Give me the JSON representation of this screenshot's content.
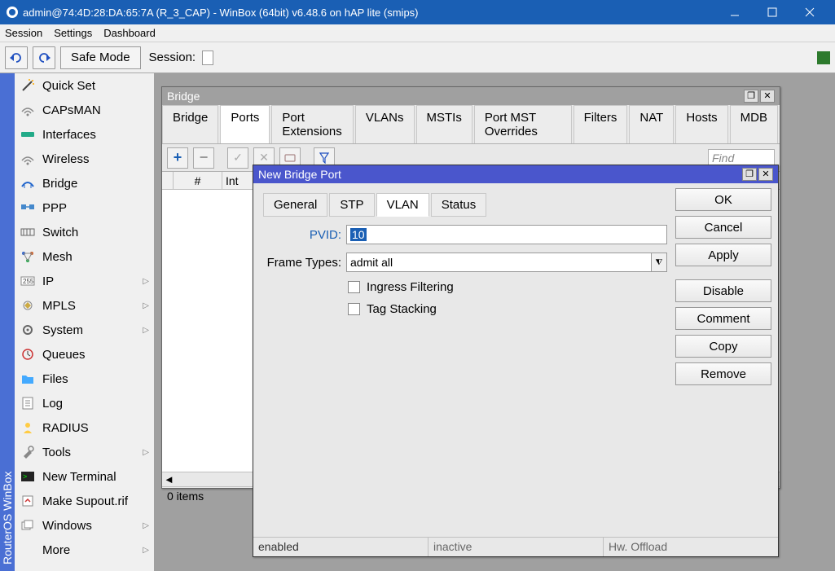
{
  "title": "admin@74:4D:28:DA:65:7A (R_3_CAP) - WinBox (64bit) v6.48.6 on hAP lite (smips)",
  "menubar": [
    "Session",
    "Settings",
    "Dashboard"
  ],
  "toolbar": {
    "safe_mode": "Safe Mode",
    "session_label": "Session:"
  },
  "vertical_brand": "RouterOS WinBox",
  "sidebar": [
    {
      "label": "Quick Set",
      "icon": "wand"
    },
    {
      "label": "CAPsMAN",
      "icon": "wifi"
    },
    {
      "label": "Interfaces",
      "icon": "iface"
    },
    {
      "label": "Wireless",
      "icon": "wifi"
    },
    {
      "label": "Bridge",
      "icon": "bridge"
    },
    {
      "label": "PPP",
      "icon": "ppp"
    },
    {
      "label": "Switch",
      "icon": "switch"
    },
    {
      "label": "Mesh",
      "icon": "mesh"
    },
    {
      "label": "IP",
      "icon": "ip",
      "submenu": true
    },
    {
      "label": "MPLS",
      "icon": "mpls",
      "submenu": true
    },
    {
      "label": "System",
      "icon": "system",
      "submenu": true
    },
    {
      "label": "Queues",
      "icon": "queues"
    },
    {
      "label": "Files",
      "icon": "files"
    },
    {
      "label": "Log",
      "icon": "log"
    },
    {
      "label": "RADIUS",
      "icon": "radius"
    },
    {
      "label": "Tools",
      "icon": "tools",
      "submenu": true
    },
    {
      "label": "New Terminal",
      "icon": "terminal"
    },
    {
      "label": "Make Supout.rif",
      "icon": "supout"
    },
    {
      "label": "Windows",
      "icon": "windows",
      "submenu": true
    },
    {
      "label": "More",
      "icon": "",
      "submenu": true
    }
  ],
  "bridge_window": {
    "title": "Bridge",
    "tabs": [
      "Bridge",
      "Ports",
      "Port Extensions",
      "VLANs",
      "MSTIs",
      "Port MST Overrides",
      "Filters",
      "NAT",
      "Hosts",
      "MDB"
    ],
    "active_tab": 1,
    "find_placeholder": "Find",
    "columns": [
      "#",
      "Int"
    ],
    "status": "0 items"
  },
  "modal": {
    "title": "New Bridge Port",
    "tabs": [
      "General",
      "STP",
      "VLAN",
      "Status"
    ],
    "active_tab": 2,
    "form": {
      "pvid_label": "PVID:",
      "pvid_value": "10",
      "frame_types_label": "Frame Types:",
      "frame_types_value": "admit all",
      "ingress_label": "Ingress Filtering",
      "tag_stacking_label": "Tag Stacking"
    },
    "buttons": [
      "OK",
      "Cancel",
      "Apply",
      "Disable",
      "Comment",
      "Copy",
      "Remove"
    ],
    "status": [
      "enabled",
      "inactive",
      "Hw. Offload"
    ]
  }
}
